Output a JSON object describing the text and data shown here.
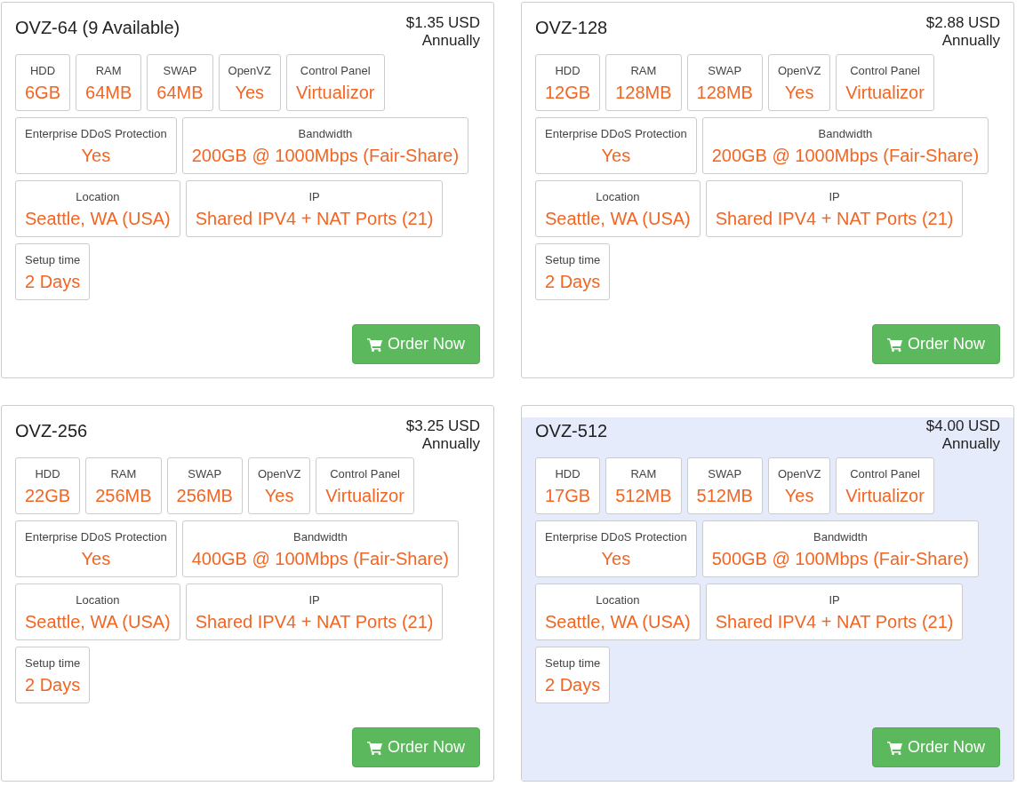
{
  "plans": [
    {
      "title": "OVZ-64 (9 Available)",
      "price": "$1.35 USD",
      "period": "Annually",
      "highlighted": false,
      "specs": [
        {
          "label": "HDD",
          "value": "6GB"
        },
        {
          "label": "RAM",
          "value": "64MB"
        },
        {
          "label": "SWAP",
          "value": "64MB"
        },
        {
          "label": "OpenVZ",
          "value": "Yes"
        },
        {
          "label": "Control Panel",
          "value": "Virtualizor"
        },
        {
          "label": "Enterprise DDoS Protection",
          "value": "Yes"
        },
        {
          "label": "Bandwidth",
          "value": "200GB @ 1000Mbps (Fair-Share)"
        },
        {
          "label": "Location",
          "value": "Seattle, WA (USA)"
        },
        {
          "label": "IP",
          "value": "Shared IPV4 + NAT Ports (21)"
        },
        {
          "label": "Setup time",
          "value": "2 Days"
        }
      ],
      "button": "Order Now"
    },
    {
      "title": "OVZ-128",
      "price": "$2.88 USD",
      "period": "Annually",
      "highlighted": false,
      "specs": [
        {
          "label": "HDD",
          "value": "12GB"
        },
        {
          "label": "RAM",
          "value": "128MB"
        },
        {
          "label": "SWAP",
          "value": "128MB"
        },
        {
          "label": "OpenVZ",
          "value": "Yes"
        },
        {
          "label": "Control Panel",
          "value": "Virtualizor"
        },
        {
          "label": "Enterprise DDoS Protection",
          "value": "Yes"
        },
        {
          "label": "Bandwidth",
          "value": "200GB @ 1000Mbps (Fair-Share)"
        },
        {
          "label": "Location",
          "value": "Seattle, WA (USA)"
        },
        {
          "label": "IP",
          "value": "Shared IPV4 + NAT Ports (21)"
        },
        {
          "label": "Setup time",
          "value": "2 Days"
        }
      ],
      "button": "Order Now"
    },
    {
      "title": "OVZ-256",
      "price": "$3.25 USD",
      "period": "Annually",
      "highlighted": false,
      "specs": [
        {
          "label": "HDD",
          "value": "22GB"
        },
        {
          "label": "RAM",
          "value": "256MB"
        },
        {
          "label": "SWAP",
          "value": "256MB"
        },
        {
          "label": "OpenVZ",
          "value": "Yes"
        },
        {
          "label": "Control Panel",
          "value": "Virtualizor"
        },
        {
          "label": "Enterprise DDoS Protection",
          "value": "Yes"
        },
        {
          "label": "Bandwidth",
          "value": "400GB @ 100Mbps (Fair-Share)"
        },
        {
          "label": "Location",
          "value": "Seattle, WA (USA)"
        },
        {
          "label": "IP",
          "value": "Shared IPV4 + NAT Ports (21)"
        },
        {
          "label": "Setup time",
          "value": "2 Days"
        }
      ],
      "button": "Order Now"
    },
    {
      "title": "OVZ-512",
      "price": "$4.00 USD",
      "period": "Annually",
      "highlighted": true,
      "specs": [
        {
          "label": "HDD",
          "value": "17GB"
        },
        {
          "label": "RAM",
          "value": "512MB"
        },
        {
          "label": "SWAP",
          "value": "512MB"
        },
        {
          "label": "OpenVZ",
          "value": "Yes"
        },
        {
          "label": "Control Panel",
          "value": "Virtualizor"
        },
        {
          "label": "Enterprise DDoS Protection",
          "value": "Yes"
        },
        {
          "label": "Bandwidth",
          "value": "500GB @ 100Mbps (Fair-Share)"
        },
        {
          "label": "Location",
          "value": "Seattle, WA (USA)"
        },
        {
          "label": "IP",
          "value": "Shared IPV4 + NAT Ports (21)"
        },
        {
          "label": "Setup time",
          "value": "2 Days"
        }
      ],
      "button": "Order Now"
    }
  ]
}
